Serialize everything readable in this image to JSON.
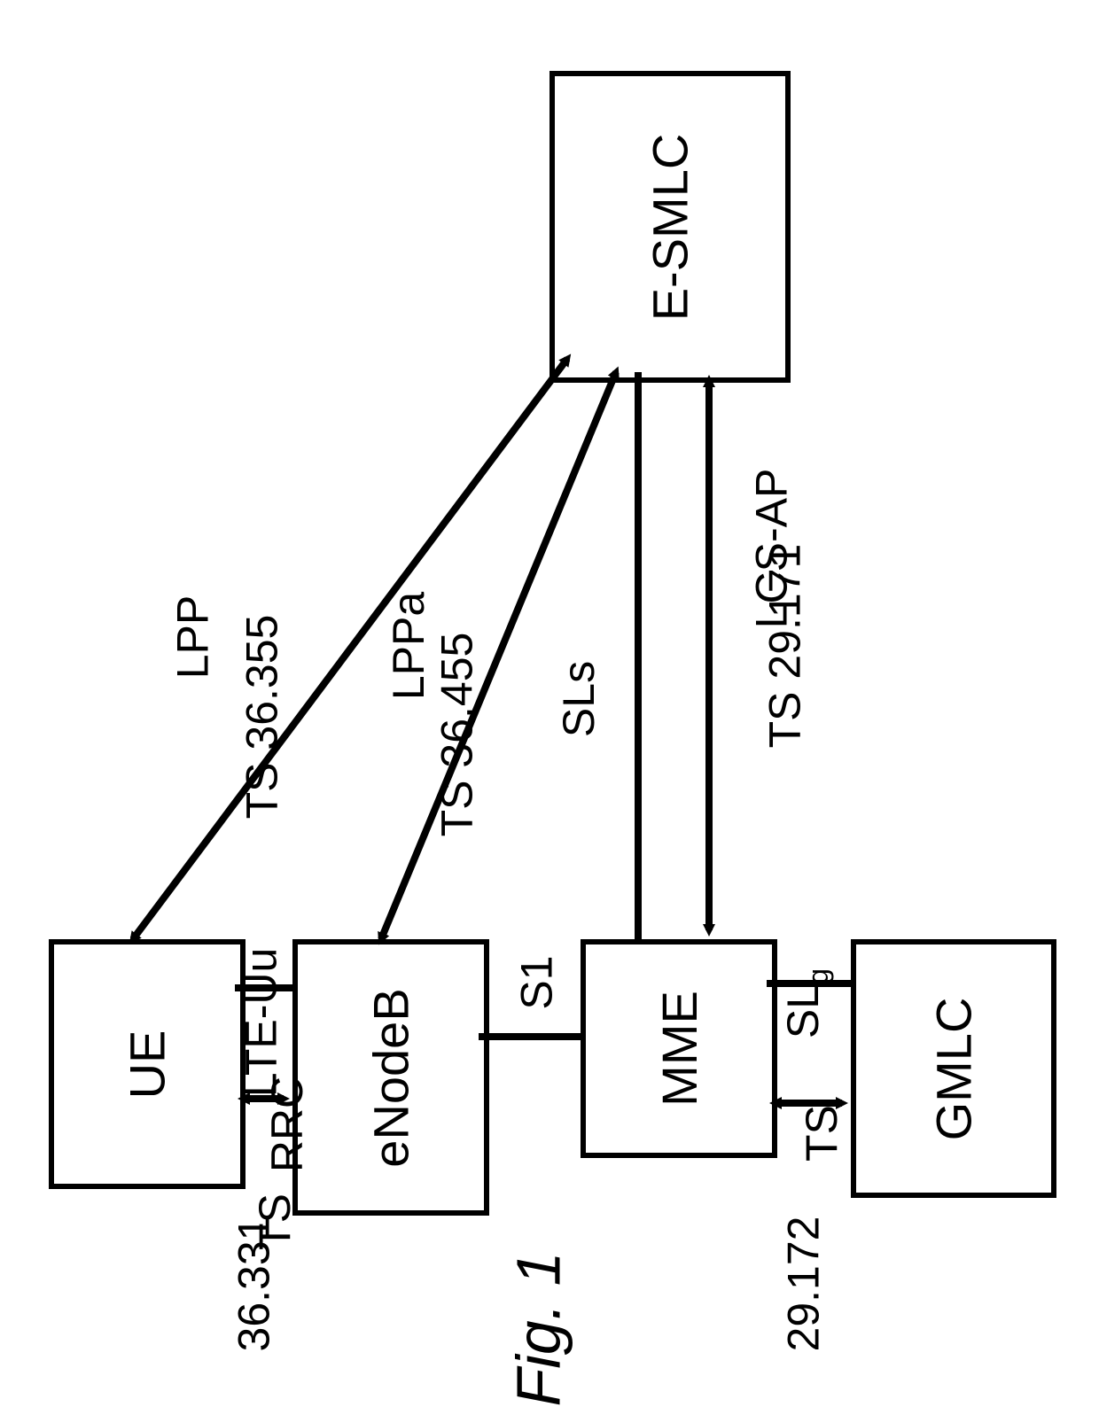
{
  "nodes": {
    "esmlc": "E-SMLC",
    "ue": "UE",
    "enodeb": "eNodeB",
    "mme": "MME",
    "gmlc": "GMLC"
  },
  "edges": {
    "lpp": {
      "label1": "LPP",
      "label2": "TS 36.355"
    },
    "lppa": {
      "label1": "LPPa",
      "label2": "TS 36.455"
    },
    "sls": {
      "label1": "SLs"
    },
    "lcsap": {
      "label1": "LCS-AP",
      "label2": "TS 29.171"
    },
    "lteuu": {
      "iface": "LTE-Uu",
      "proto": "RRC",
      "ts": "TS",
      "num": "36.331"
    },
    "s1": {
      "label": "S1"
    },
    "slg": {
      "iface_html": "SL<span class=\"sub\">g</span>",
      "ts": "TS",
      "num": "29.172"
    }
  },
  "caption": "Fig. 1"
}
